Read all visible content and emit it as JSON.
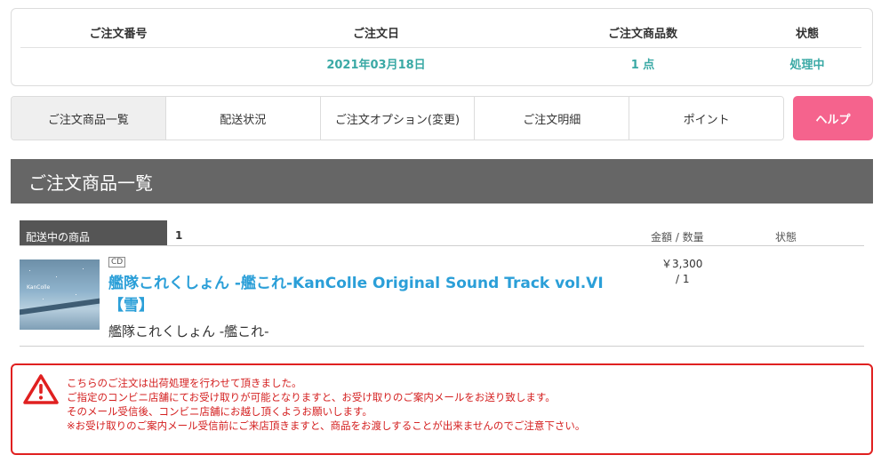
{
  "order_summary": {
    "headers": [
      "ご注文番号",
      "ご注文日",
      "ご注文商品数",
      "状態"
    ],
    "values": [
      "",
      "2021年03月18日",
      "1 点",
      "処理中"
    ]
  },
  "tabs": [
    "ご注文商品一覧",
    "配送状況",
    "ご注文オプション(変更)",
    "ご注文明細",
    "ポイント"
  ],
  "help_label": "ヘルプ",
  "section_title": "ご注文商品一覧",
  "list_header": {
    "shipping_label": "配送中の商品",
    "shipping_count": "1",
    "price_qty_label": "金額 / 数量",
    "status_label": "状態"
  },
  "item": {
    "format_tag": "CD",
    "title": "艦隊これくしょん -艦これ-KanColle Original Sound Track vol.VI 【雪】",
    "artist": "艦隊これくしょん -艦これ-",
    "price": "￥3,300",
    "quantity": "/ 1",
    "thumb_text": "KanColle"
  },
  "notice": {
    "icon": "warning-triangle-icon",
    "lines": [
      "こちらのご注文は出荷処理を行わせて頂きました。",
      "ご指定のコンビニ店舗にてお受け取りが可能となりますと、お受け取りのご案内メールをお送り致します。",
      "そのメール受信後、コンビニ店舗にお越し頂くようお願いします。",
      "※お受け取りのご案内メール受信前にご来店頂きますと、商品をお渡しすることが出来ませんのでご注意下さい。"
    ]
  },
  "colors": {
    "accent_teal": "#3aa9a5",
    "help_pink": "#f5638d",
    "link_blue": "#2b9fd8",
    "notice_red": "#e02020"
  }
}
